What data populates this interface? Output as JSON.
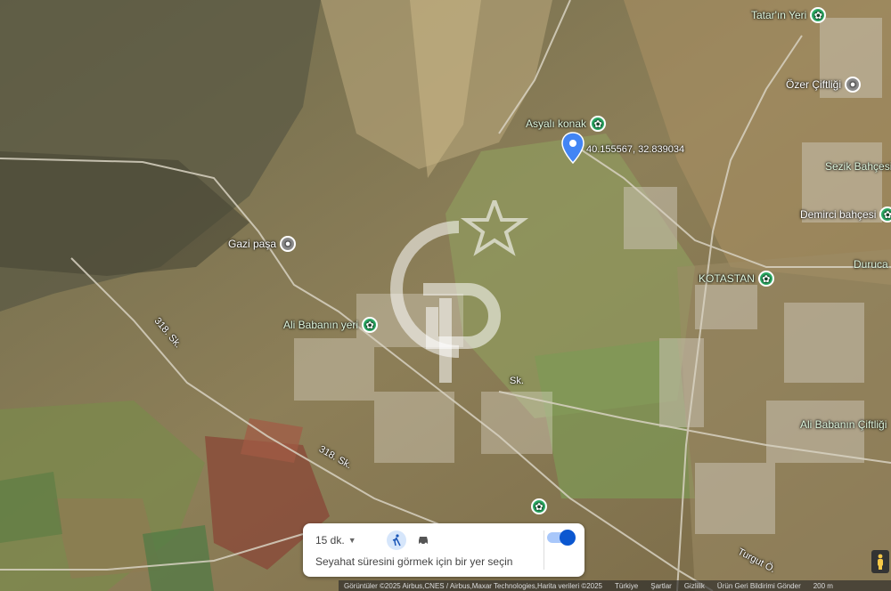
{
  "pois": [
    {
      "id": "tatarin",
      "label": "Tatar'ın Yeri",
      "kind": "green",
      "icon": "flower-icon"
    },
    {
      "id": "ozer",
      "label": "Özer Çiftliği",
      "kind": "grey",
      "icon": "pin-icon"
    },
    {
      "id": "asyali",
      "label": "Asyalı konak",
      "kind": "green",
      "icon": "flower-icon"
    },
    {
      "id": "sezik",
      "label": "Sezik Bahçesi",
      "kind": "green",
      "icon": "flower-icon"
    },
    {
      "id": "demirci",
      "label": "Demirci bahçesi",
      "kind": "green",
      "icon": "flower-icon"
    },
    {
      "id": "gazi",
      "label": "Gazi paşa",
      "kind": "grey",
      "icon": "pin-icon"
    },
    {
      "id": "durucan",
      "label": "Duruca",
      "kind": "green",
      "icon": "flower-icon"
    },
    {
      "id": "kotastan",
      "label": "KOTASTAN",
      "kind": "green",
      "icon": "flower-icon"
    },
    {
      "id": "alibaba",
      "label": "Ali Babanın yeri",
      "kind": "green",
      "icon": "flower-icon"
    },
    {
      "id": "alibabaciftlik",
      "label": "Ali Babanın Çiftliği",
      "kind": "green",
      "icon": "flower-icon"
    }
  ],
  "pin": {
    "coords": "40.155567, 32.839034",
    "icon": "location-pin-icon",
    "color": "#4285f4"
  },
  "roads": {
    "r1": "318. Sk.",
    "r2": "318. Sk.",
    "r3": "Turgut Ö.",
    "r4": "Sk."
  },
  "travel": {
    "time": "15 dk.",
    "message": "Seyahat süresini görmek için bir yer seçin",
    "walk_icon": "walk-icon",
    "car_icon": "car-icon"
  },
  "footer": {
    "imagery": "Görüntüler ©2025 Airbus,CNES / Airbus,Maxar Technologies,Harita verileri ©2025",
    "country": "Türkiye",
    "terms": "Şartlar",
    "privacy": "Gizlilik",
    "feedback": "Ürün Geri Bildirimi Gönder",
    "scale": "200 m"
  },
  "colors": {
    "poi_green": "#2fb36a",
    "poi_grey": "#8c8c8c",
    "accent": "#0b57d0"
  }
}
